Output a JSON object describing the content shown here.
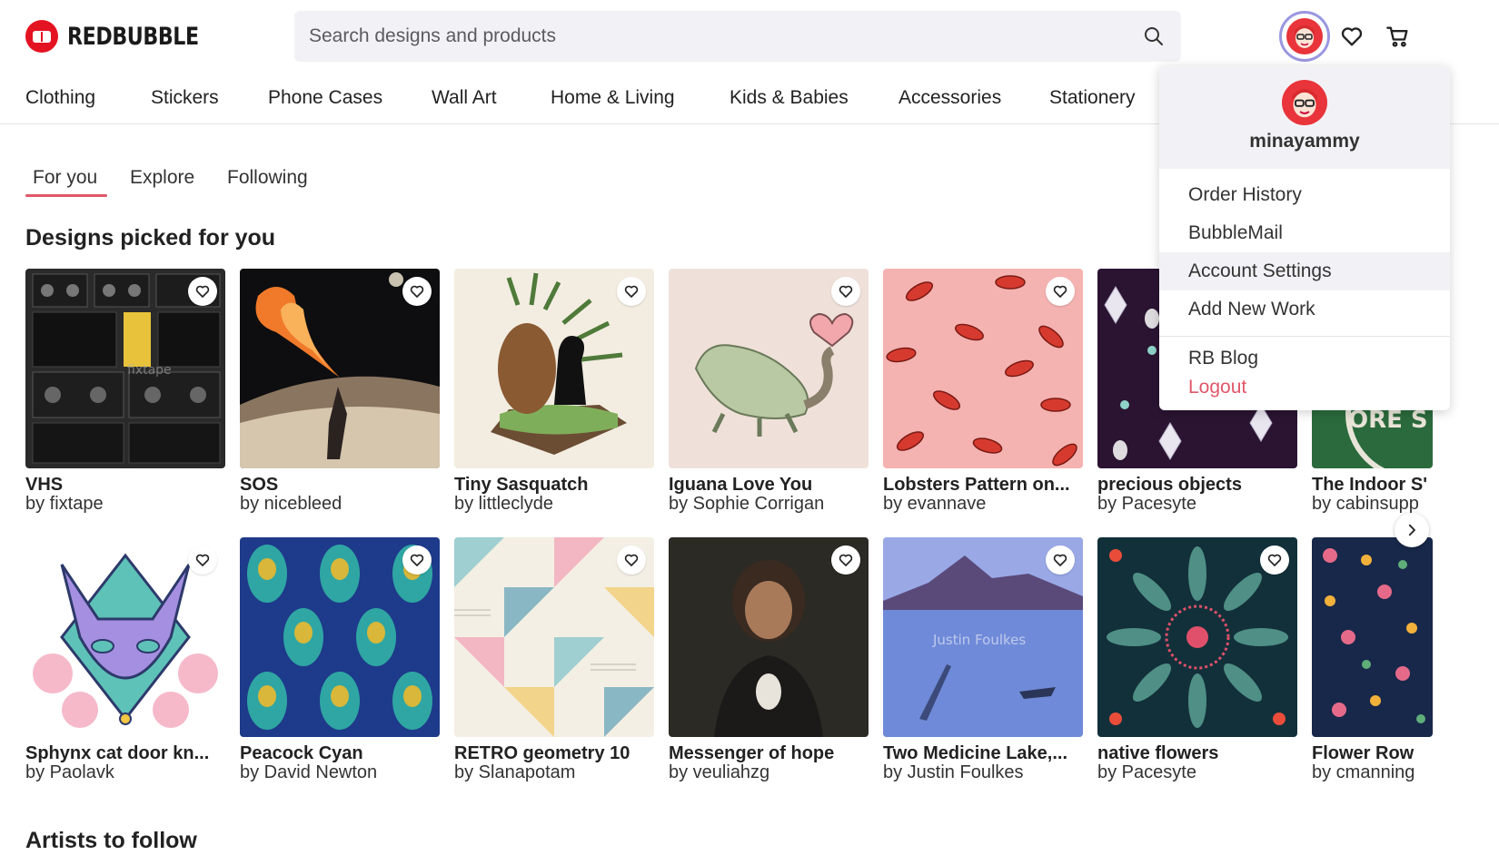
{
  "brand": {
    "name": "REDBUBBLE",
    "accent": "#e41321"
  },
  "search": {
    "placeholder": "Search designs and products"
  },
  "nav": {
    "categories": [
      "Clothing",
      "Stickers",
      "Phone Cases",
      "Wall Art",
      "Home & Living",
      "Kids & Babies",
      "Accessories",
      "Stationery"
    ]
  },
  "tabs": {
    "items": [
      "For you",
      "Explore",
      "Following"
    ],
    "active": "For you"
  },
  "sections": {
    "designs_title": "Designs picked for you",
    "artists_title": "Artists to follow"
  },
  "designs": [
    {
      "title": "VHS",
      "artist": "by fixtape",
      "watermark": "fixtape"
    },
    {
      "title": "SOS",
      "artist": "by nicebleed"
    },
    {
      "title": "Tiny Sasquatch",
      "artist": "by littleclyde"
    },
    {
      "title": "Iguana Love You",
      "artist": "by Sophie Corrigan"
    },
    {
      "title": "Lobsters Pattern on...",
      "artist": "by evannave"
    },
    {
      "title": "precious objects",
      "artist": "by Pacesyte"
    },
    {
      "title": "The Indoor S'",
      "artist": "by cabinsupp",
      "badge": "ORE S"
    },
    {
      "title": "Sphynx cat door kn...",
      "artist": "by Paolavk"
    },
    {
      "title": "Peacock Cyan",
      "artist": "by David Newton"
    },
    {
      "title": "RETRO geometry 10",
      "artist": "by Slanapotam"
    },
    {
      "title": "Messenger of hope",
      "artist": "by veuliahzg"
    },
    {
      "title": "Two Medicine Lake,...",
      "artist": "by Justin Foulkes",
      "watermark": "Justin Foulkes"
    },
    {
      "title": "native flowers",
      "artist": "by Pacesyte"
    },
    {
      "title": "Flower Row",
      "artist": "by cmanning"
    }
  ],
  "user_menu": {
    "username": "minayammy",
    "items": [
      "Order History",
      "BubbleMail",
      "Account Settings",
      "Add New Work"
    ],
    "highlighted": "Account Settings",
    "secondary": [
      "RB Blog"
    ],
    "logout": "Logout",
    "logout_color": "#e05769"
  },
  "icons": {
    "search": "search-icon",
    "wishlist": "heart-icon",
    "cart": "cart-icon",
    "favorite": "heart-outline-icon",
    "next": "chevron-right-icon"
  }
}
